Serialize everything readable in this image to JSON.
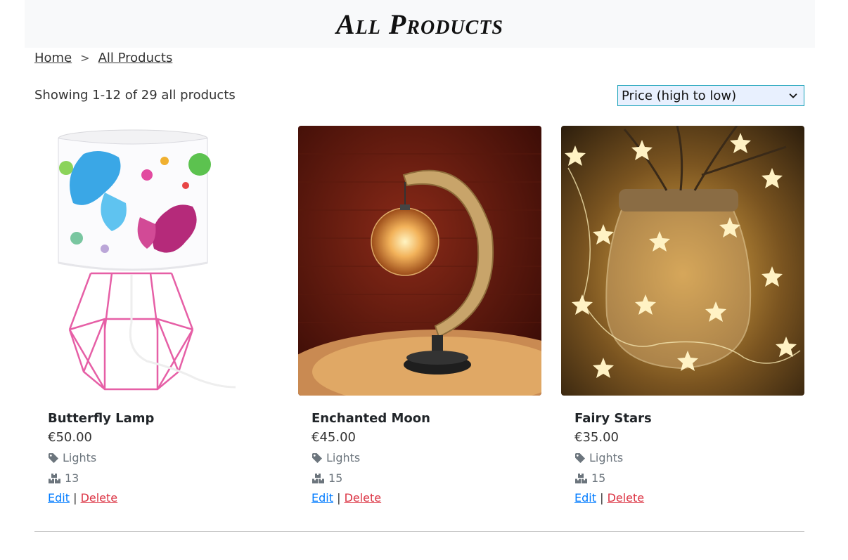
{
  "header": {
    "title": "All Products"
  },
  "breadcrumb": {
    "home": "Home",
    "separator": ">",
    "current": "All Products"
  },
  "listing": {
    "result_text": "Showing 1-12 of 29 all products",
    "sort": {
      "selected": "Price (high to low)"
    }
  },
  "colors": {
    "accent_link": "#007bff",
    "danger_link": "#dc3545",
    "select_border": "#17a2b8"
  },
  "products": [
    {
      "name": "Butterfly Lamp",
      "price": "€50.00",
      "category": "Lights",
      "stock": "13",
      "edit_label": "Edit",
      "divider": "|",
      "delete_label": "Delete"
    },
    {
      "name": "Enchanted Moon",
      "price": "€45.00",
      "category": "Lights",
      "stock": "15",
      "edit_label": "Edit",
      "divider": "|",
      "delete_label": "Delete"
    },
    {
      "name": "Fairy Stars",
      "price": "€35.00",
      "category": "Lights",
      "stock": "15",
      "edit_label": "Edit",
      "divider": "|",
      "delete_label": "Delete"
    }
  ]
}
